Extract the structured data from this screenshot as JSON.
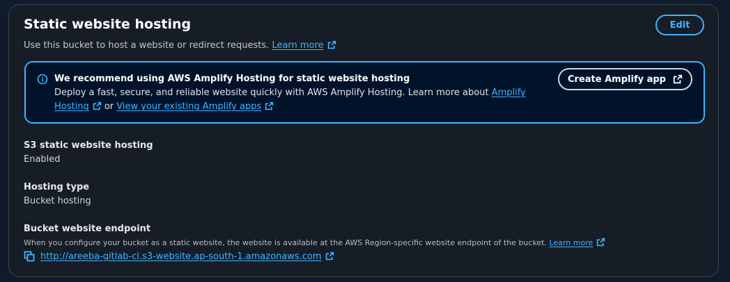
{
  "section": {
    "title": "Static website hosting",
    "description": "Use this bucket to host a website or redirect requests.",
    "learn_more": "Learn more",
    "edit_label": "Edit"
  },
  "alert": {
    "headline": "We recommend using AWS Amplify Hosting for static website hosting",
    "body_prefix": "Deploy a fast, secure, and reliable website quickly with AWS Amplify Hosting. Learn more about ",
    "amplify_hosting_link": "Amplify Hosting",
    "or_text": " or ",
    "view_apps_link": "View your existing Amplify apps",
    "button_label": "Create Amplify app"
  },
  "properties": {
    "hosting_label": "S3 static website hosting",
    "hosting_value": "Enabled",
    "type_label": "Hosting type",
    "type_value": "Bucket hosting",
    "endpoint_label": "Bucket website endpoint",
    "endpoint_desc": "When you configure your bucket as a static website, the website is available at the AWS Region-specific website endpoint of the bucket.",
    "endpoint_learn_more": "Learn more",
    "endpoint_url": "http://areeba-gitlab-ci.s3-website.ap-south-1.amazonaws.com"
  },
  "colors": {
    "accent": "#42b4ff",
    "panel_bg": "#161d26",
    "alert_bg": "#01132b"
  },
  "icons": [
    "info-icon",
    "external-link-icon",
    "copy-icon"
  ]
}
